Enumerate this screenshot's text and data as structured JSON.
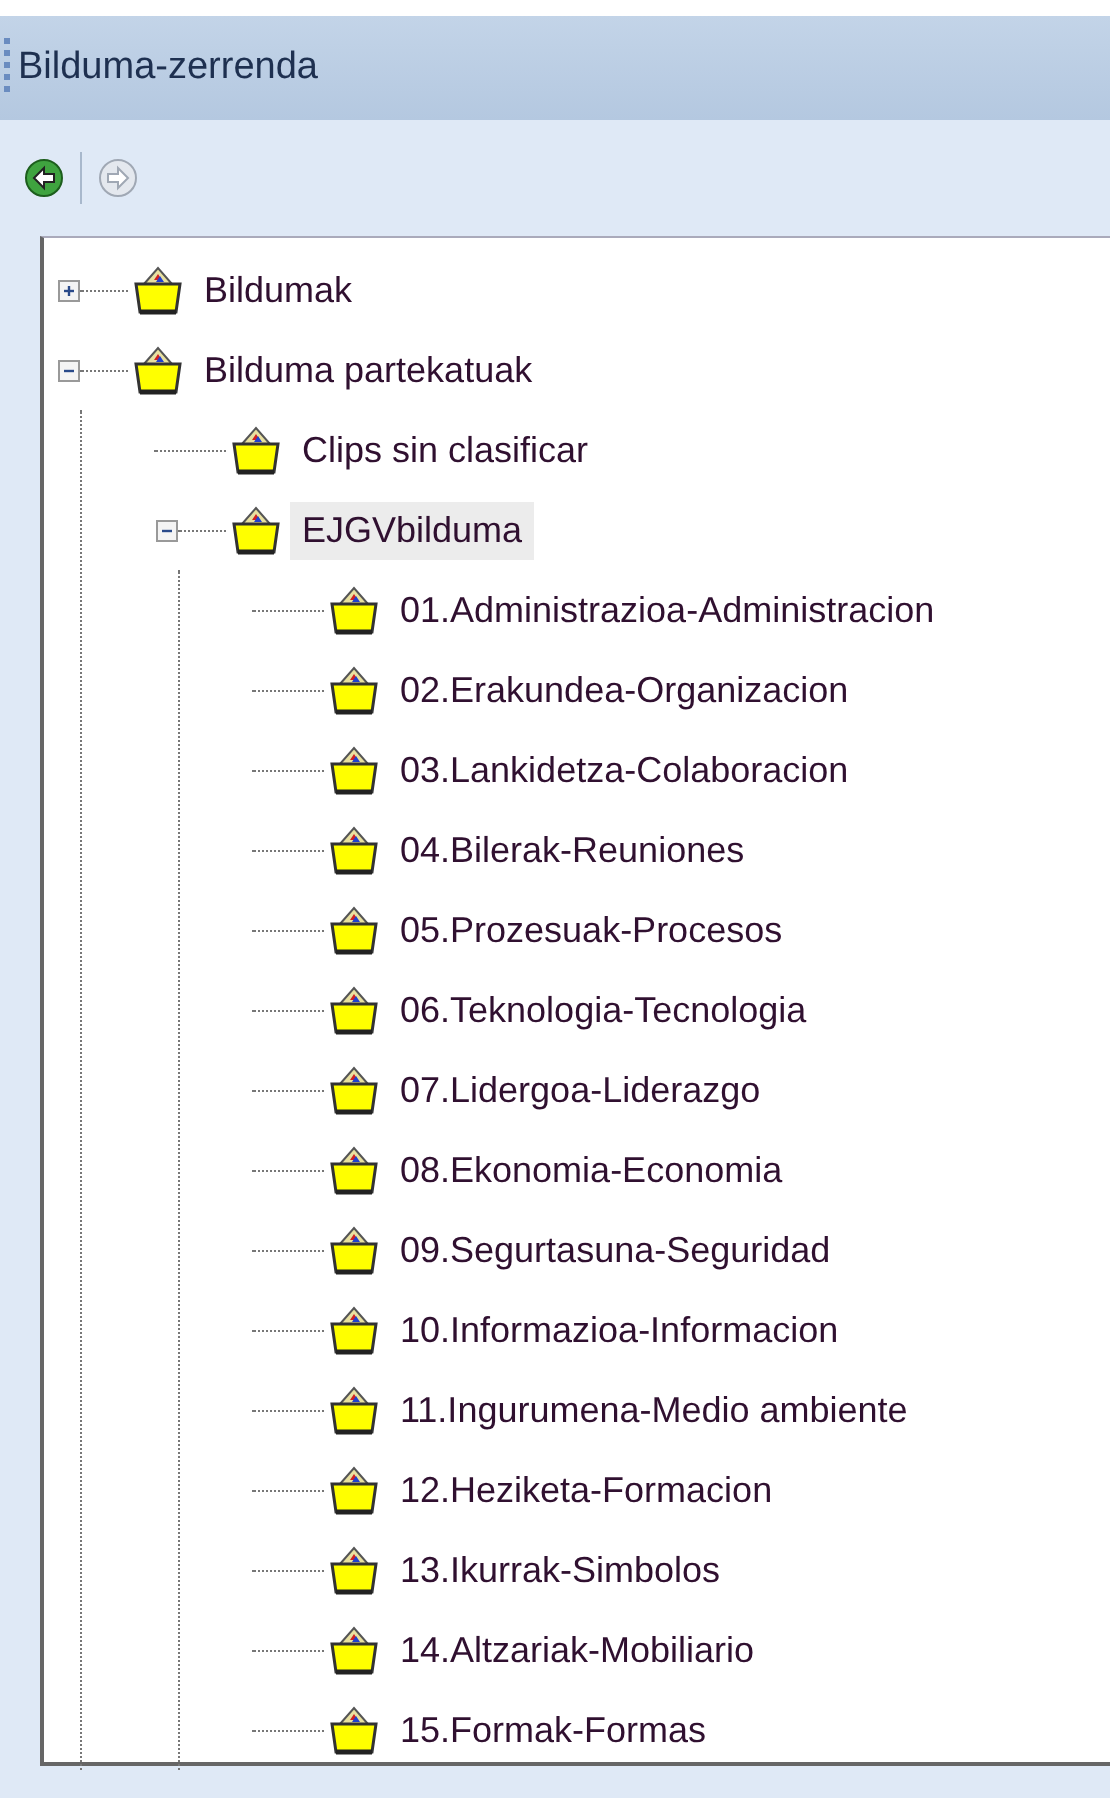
{
  "panel": {
    "title": "Bilduma-zerrenda"
  },
  "toolbar": [
    {
      "kind": "back",
      "disabled": false
    },
    {
      "kind": "forward",
      "disabled": true
    }
  ],
  "tree": [
    {
      "label": "Bildumak",
      "expanded": false,
      "selected": false
    },
    {
      "label": "Bilduma partekatuak",
      "expanded": true,
      "selected": false,
      "children": [
        {
          "label": "Clips sin clasificar",
          "selected": false
        },
        {
          "label": "EJGVbilduma",
          "expanded": true,
          "selected": true,
          "children": [
            {
              "label": "01.Administrazioa-Administracion",
              "selected": false
            },
            {
              "label": "02.Erakundea-Organizacion",
              "selected": false
            },
            {
              "label": "03.Lankidetza-Colaboracion",
              "selected": false
            },
            {
              "label": "04.Bilerak-Reuniones",
              "selected": false
            },
            {
              "label": "05.Prozesuak-Procesos",
              "selected": false
            },
            {
              "label": "06.Teknologia-Tecnologia",
              "selected": false
            },
            {
              "label": "07.Lidergoa-Liderazgo",
              "selected": false
            },
            {
              "label": "08.Ekonomia-Economia",
              "selected": false
            },
            {
              "label": "09.Segurtasuna-Seguridad",
              "selected": false
            },
            {
              "label": "10.Informazioa-Informacion",
              "selected": false
            },
            {
              "label": "11.Ingurumena-Medio ambiente",
              "selected": false
            },
            {
              "label": "12.Heziketa-Formacion",
              "selected": false
            },
            {
              "label": "13.Ikurrak-Simbolos",
              "selected": false
            },
            {
              "label": "14.Altzariak-Mobiliario",
              "selected": false
            },
            {
              "label": "15.Formak-Formas",
              "selected": false
            }
          ]
        }
      ]
    }
  ]
}
